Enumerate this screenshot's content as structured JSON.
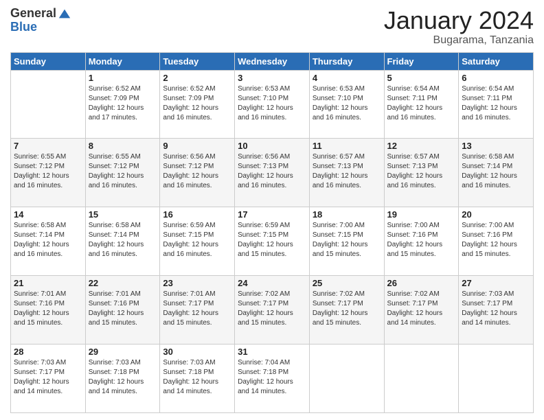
{
  "header": {
    "logo_general": "General",
    "logo_blue": "Blue",
    "month_year": "January 2024",
    "location": "Bugarama, Tanzania"
  },
  "days_of_week": [
    "Sunday",
    "Monday",
    "Tuesday",
    "Wednesday",
    "Thursday",
    "Friday",
    "Saturday"
  ],
  "weeks": [
    [
      {
        "day": "",
        "sunrise": "",
        "sunset": "",
        "daylight": ""
      },
      {
        "day": "1",
        "sunrise": "Sunrise: 6:52 AM",
        "sunset": "Sunset: 7:09 PM",
        "daylight": "Daylight: 12 hours and 17 minutes."
      },
      {
        "day": "2",
        "sunrise": "Sunrise: 6:52 AM",
        "sunset": "Sunset: 7:09 PM",
        "daylight": "Daylight: 12 hours and 16 minutes."
      },
      {
        "day": "3",
        "sunrise": "Sunrise: 6:53 AM",
        "sunset": "Sunset: 7:10 PM",
        "daylight": "Daylight: 12 hours and 16 minutes."
      },
      {
        "day": "4",
        "sunrise": "Sunrise: 6:53 AM",
        "sunset": "Sunset: 7:10 PM",
        "daylight": "Daylight: 12 hours and 16 minutes."
      },
      {
        "day": "5",
        "sunrise": "Sunrise: 6:54 AM",
        "sunset": "Sunset: 7:11 PM",
        "daylight": "Daylight: 12 hours and 16 minutes."
      },
      {
        "day": "6",
        "sunrise": "Sunrise: 6:54 AM",
        "sunset": "Sunset: 7:11 PM",
        "daylight": "Daylight: 12 hours and 16 minutes."
      }
    ],
    [
      {
        "day": "7",
        "sunrise": "",
        "sunset": "",
        "daylight": ""
      },
      {
        "day": "8",
        "sunrise": "Sunrise: 6:55 AM",
        "sunset": "Sunset: 7:12 PM",
        "daylight": "Daylight: 12 hours and 16 minutes."
      },
      {
        "day": "9",
        "sunrise": "Sunrise: 6:56 AM",
        "sunset": "Sunset: 7:12 PM",
        "daylight": "Daylight: 12 hours and 16 minutes."
      },
      {
        "day": "10",
        "sunrise": "Sunrise: 6:56 AM",
        "sunset": "Sunset: 7:13 PM",
        "daylight": "Daylight: 12 hours and 16 minutes."
      },
      {
        "day": "11",
        "sunrise": "Sunrise: 6:57 AM",
        "sunset": "Sunset: 7:13 PM",
        "daylight": "Daylight: 12 hours and 16 minutes."
      },
      {
        "day": "12",
        "sunrise": "Sunrise: 6:57 AM",
        "sunset": "Sunset: 7:13 PM",
        "daylight": "Daylight: 12 hours and 16 minutes."
      },
      {
        "day": "13",
        "sunrise": "Sunrise: 6:58 AM",
        "sunset": "Sunset: 7:14 PM",
        "daylight": "Daylight: 12 hours and 16 minutes."
      }
    ],
    [
      {
        "day": "14",
        "sunrise": "",
        "sunset": "",
        "daylight": ""
      },
      {
        "day": "15",
        "sunrise": "Sunrise: 6:58 AM",
        "sunset": "Sunset: 7:14 PM",
        "daylight": "Daylight: 12 hours and 16 minutes."
      },
      {
        "day": "16",
        "sunrise": "Sunrise: 6:59 AM",
        "sunset": "Sunset: 7:15 PM",
        "daylight": "Daylight: 12 hours and 16 minutes."
      },
      {
        "day": "17",
        "sunrise": "Sunrise: 6:59 AM",
        "sunset": "Sunset: 7:15 PM",
        "daylight": "Daylight: 12 hours and 15 minutes."
      },
      {
        "day": "18",
        "sunrise": "Sunrise: 7:00 AM",
        "sunset": "Sunset: 7:15 PM",
        "daylight": "Daylight: 12 hours and 15 minutes."
      },
      {
        "day": "19",
        "sunrise": "Sunrise: 7:00 AM",
        "sunset": "Sunset: 7:16 PM",
        "daylight": "Daylight: 12 hours and 15 minutes."
      },
      {
        "day": "20",
        "sunrise": "Sunrise: 7:00 AM",
        "sunset": "Sunset: 7:16 PM",
        "daylight": "Daylight: 12 hours and 15 minutes."
      }
    ],
    [
      {
        "day": "21",
        "sunrise": "",
        "sunset": "",
        "daylight": ""
      },
      {
        "day": "22",
        "sunrise": "Sunrise: 7:01 AM",
        "sunset": "Sunset: 7:16 PM",
        "daylight": "Daylight: 12 hours and 15 minutes."
      },
      {
        "day": "23",
        "sunrise": "Sunrise: 7:01 AM",
        "sunset": "Sunset: 7:17 PM",
        "daylight": "Daylight: 12 hours and 15 minutes."
      },
      {
        "day": "24",
        "sunrise": "Sunrise: 7:02 AM",
        "sunset": "Sunset: 7:17 PM",
        "daylight": "Daylight: 12 hours and 15 minutes."
      },
      {
        "day": "25",
        "sunrise": "Sunrise: 7:02 AM",
        "sunset": "Sunset: 7:17 PM",
        "daylight": "Daylight: 12 hours and 15 minutes."
      },
      {
        "day": "26",
        "sunrise": "Sunrise: 7:02 AM",
        "sunset": "Sunset: 7:17 PM",
        "daylight": "Daylight: 12 hours and 14 minutes."
      },
      {
        "day": "27",
        "sunrise": "Sunrise: 7:03 AM",
        "sunset": "Sunset: 7:17 PM",
        "daylight": "Daylight: 12 hours and 14 minutes."
      }
    ],
    [
      {
        "day": "28",
        "sunrise": "",
        "sunset": "",
        "daylight": ""
      },
      {
        "day": "29",
        "sunrise": "Sunrise: 7:03 AM",
        "sunset": "Sunset: 7:18 PM",
        "daylight": "Daylight: 12 hours and 14 minutes."
      },
      {
        "day": "30",
        "sunrise": "Sunrise: 7:03 AM",
        "sunset": "Sunset: 7:18 PM",
        "daylight": "Daylight: 12 hours and 14 minutes."
      },
      {
        "day": "31",
        "sunrise": "Sunrise: 7:04 AM",
        "sunset": "Sunset: 7:18 PM",
        "daylight": "Daylight: 12 hours and 14 minutes."
      },
      {
        "day": "",
        "sunrise": "",
        "sunset": "",
        "daylight": ""
      },
      {
        "day": "",
        "sunrise": "",
        "sunset": "",
        "daylight": ""
      },
      {
        "day": "",
        "sunrise": "",
        "sunset": "",
        "daylight": ""
      }
    ]
  ],
  "week1_day7_sunrise": "Sunrise: 6:55 AM",
  "week1_day7_sunset": "Sunset: 7:12 PM",
  "week1_day7_daylight": "Daylight: 12 hours and 16 minutes.",
  "week2_day14_sunrise": "Sunrise: 6:58 AM",
  "week2_day14_sunset": "Sunset: 7:14 PM",
  "week2_day14_daylight": "Daylight: 12 hours and 16 minutes.",
  "week3_day21_sunrise": "Sunrise: 7:01 AM",
  "week3_day21_sunset": "Sunset: 7:16 PM",
  "week3_day21_daylight": "Daylight: 12 hours and 15 minutes.",
  "week4_day28_sunrise": "Sunrise: 7:03 AM",
  "week4_day28_sunset": "Sunset: 7:17 PM",
  "week4_day28_daylight": "Daylight: 12 hours and 14 minutes."
}
